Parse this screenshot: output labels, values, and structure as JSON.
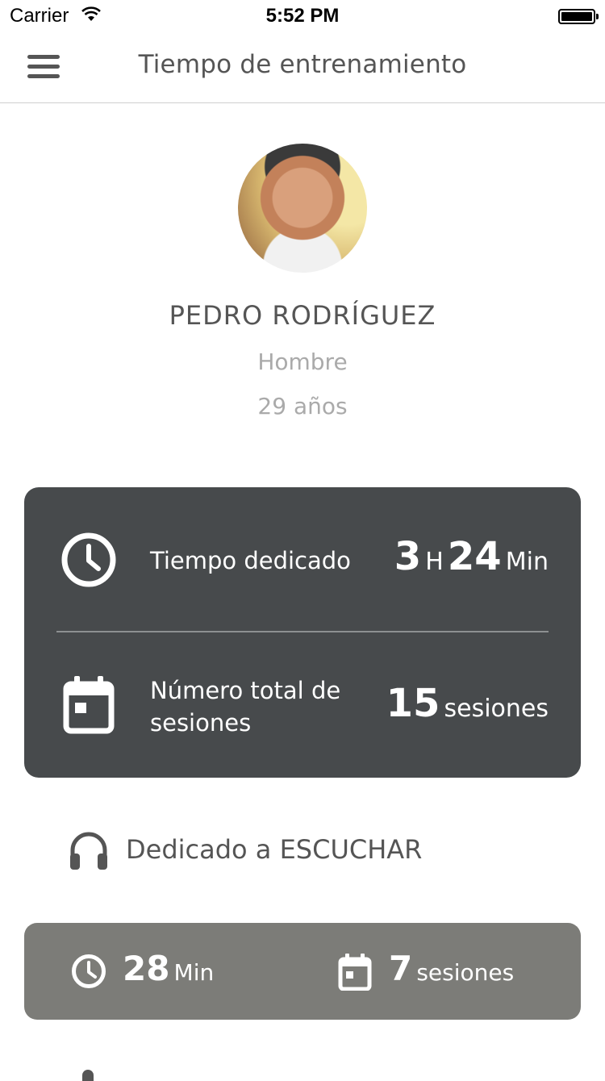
{
  "status_bar": {
    "carrier": "Carrier",
    "time": "5:52 PM"
  },
  "nav": {
    "title": "Tiempo de entrenamiento",
    "menu_icon": "hamburger-menu-icon"
  },
  "profile": {
    "name": "PEDRO RODRÍGUEZ",
    "gender": "Hombre",
    "age": "29 años"
  },
  "stats": {
    "time_label": "Tiempo dedicado",
    "time_hours": "3",
    "time_hours_unit": "H",
    "time_minutes": "24",
    "time_minutes_unit": "Min",
    "sessions_label": "Número total de sesiones",
    "sessions_value": "15",
    "sessions_unit": "sesiones"
  },
  "listen": {
    "label": "Dedicado a ESCUCHAR",
    "minutes": "28",
    "minutes_unit": "Min",
    "sessions": "7",
    "sessions_unit": "sesiones"
  },
  "colors": {
    "card_dark": "#474a4c",
    "card_grey": "#7c7c78",
    "text": "#555555",
    "muted": "#aaaaaa"
  }
}
